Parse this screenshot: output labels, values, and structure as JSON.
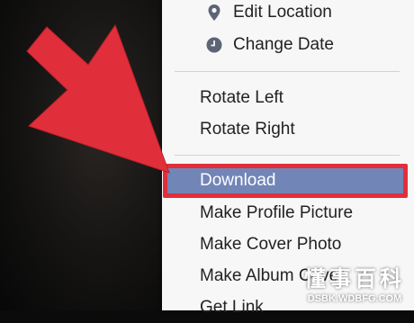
{
  "menu": {
    "edit_location": "Edit Location",
    "change_date": "Change Date",
    "rotate_left": "Rotate Left",
    "rotate_right": "Rotate Right",
    "download": "Download",
    "make_profile_picture": "Make Profile Picture",
    "make_cover_photo": "Make Cover Photo",
    "make_album_cover": "Make Album Cover",
    "get_link": "Get Link"
  },
  "icons": {
    "edit_location": "map-pin-icon",
    "change_date": "clock-icon"
  },
  "colors": {
    "menu_bg": "#f7f7f7",
    "highlight": "#7285b7",
    "highlight_border": "#e02f3b",
    "arrow": "#e02f3b",
    "text": "#222222"
  },
  "watermark": {
    "main": "懂事百科",
    "sub": "DSBK.WDBFG.COM"
  }
}
